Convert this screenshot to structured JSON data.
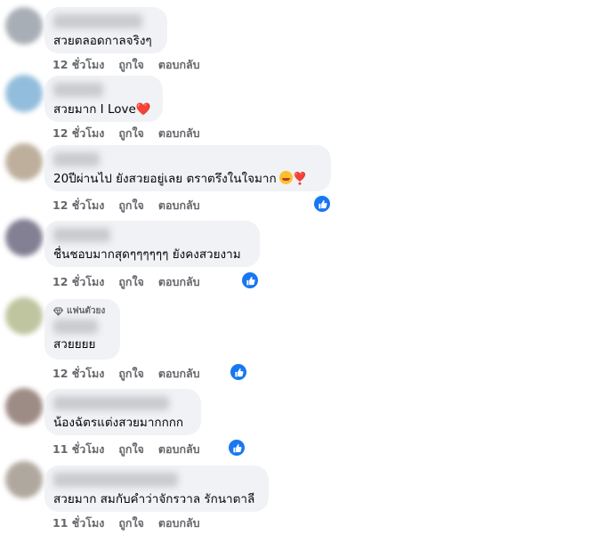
{
  "colors": {
    "bubble": "#f0f2f5",
    "meta_text": "#65676b",
    "like_blue": "#1877f2",
    "heart_red": "#e41e3f"
  },
  "comments": [
    {
      "text": "สวยตลอดกาลจริงๆ",
      "time": "12 ชั่วโมง",
      "like": "ถูกใจ",
      "reply": "ตอบกลับ",
      "reaction": null
    },
    {
      "text": "สวยมาก I Love",
      "emoji": "❤️",
      "time": "12 ชั่วโมง",
      "like": "ถูกใจ",
      "reply": "ตอบกลับ",
      "reaction": null
    },
    {
      "text": "20ปีผ่านไป ยังสวยอยู่เลย ตราตรึงในใจมาก",
      "emoji": "❣️",
      "time": "12 ชั่วโมง",
      "like": "ถูกใจ",
      "reply": "ตอบกลับ",
      "reaction": "like-icon"
    },
    {
      "text": "ชื่นชอบมากสุดๆๆๆๆๆๆ ยังคงสวยงาม",
      "time": "12 ชั่วโมง",
      "like": "ถูกใจ",
      "reply": "ตอบกลับ",
      "reaction": "like-icon"
    },
    {
      "badge": "แฟนตัวยง",
      "text": "สวยยยย",
      "time": "12 ชั่วโมง",
      "like": "ถูกใจ",
      "reply": "ตอบกลับ",
      "reaction": "like-icon"
    },
    {
      "text": "น้องฉัตรแต่งสวยมากกกก",
      "time": "11 ชั่วโมง",
      "like": "ถูกใจ",
      "reply": "ตอบกลับ",
      "reaction": "like-icon"
    },
    {
      "text": "สวยมาก สมกับคำว่าจักรวาล รักนาตาลี",
      "time": "11 ชั่วโมง",
      "like": "ถูกใจ",
      "reply": "ตอบกลับ",
      "reaction": null
    }
  ]
}
